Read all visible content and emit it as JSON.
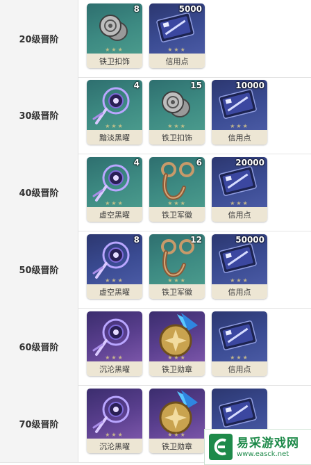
{
  "rows": [
    {
      "label": "20级晋阶",
      "items": [
        {
          "name": "铁卫扣饰",
          "qty": "8",
          "rarity": "r3",
          "icon": "silver-badge-icon"
        },
        {
          "name": "信用点",
          "qty": "5000",
          "rarity": "r4",
          "icon": "credit-card-icon"
        }
      ]
    },
    {
      "label": "30级晋阶",
      "items": [
        {
          "name": "黯淡黑曜",
          "qty": "4",
          "rarity": "r3",
          "icon": "dreamcatcher-icon"
        },
        {
          "name": "铁卫扣饰",
          "qty": "15",
          "rarity": "r3",
          "icon": "silver-badge-icon"
        },
        {
          "name": "信用点",
          "qty": "10000",
          "rarity": "r4",
          "icon": "credit-card-icon"
        }
      ]
    },
    {
      "label": "40级晋阶",
      "items": [
        {
          "name": "虚空黑曜",
          "qty": "4",
          "rarity": "r3",
          "icon": "dreamcatcher-icon"
        },
        {
          "name": "铁卫军徽",
          "qty": "6",
          "rarity": "r3",
          "icon": "bronze-clasp-icon"
        },
        {
          "name": "信用点",
          "qty": "20000",
          "rarity": "r4",
          "icon": "credit-card-icon"
        }
      ]
    },
    {
      "label": "50级晋阶",
      "items": [
        {
          "name": "虚空黑曜",
          "qty": "8",
          "rarity": "r4",
          "icon": "dreamcatcher-icon"
        },
        {
          "name": "铁卫军徽",
          "qty": "12",
          "rarity": "r3",
          "icon": "bronze-clasp-icon"
        },
        {
          "name": "信用点",
          "qty": "50000",
          "rarity": "r4",
          "icon": "credit-card-icon"
        }
      ]
    },
    {
      "label": "60级晋阶",
      "items": [
        {
          "name": "沉沦黑曜",
          "qty": "",
          "rarity": "r5",
          "icon": "dreamcatcher-icon"
        },
        {
          "name": "铁卫勋章",
          "qty": "",
          "rarity": "r5",
          "icon": "gold-medal-icon"
        },
        {
          "name": "信用点",
          "qty": "",
          "rarity": "r4",
          "icon": "credit-card-icon"
        }
      ]
    },
    {
      "label": "70级晋阶",
      "items": [
        {
          "name": "沉沦黑曜",
          "qty": "",
          "rarity": "r5",
          "icon": "dreamcatcher-icon"
        },
        {
          "name": "铁卫勋章",
          "qty": "",
          "rarity": "r5",
          "icon": "gold-medal-icon"
        },
        {
          "name": "",
          "qty": "",
          "rarity": "r4",
          "icon": "credit-card-icon"
        }
      ]
    }
  ],
  "stars": "★★★",
  "watermark": {
    "title": "易采游戏网",
    "url": "www.easck.net"
  }
}
